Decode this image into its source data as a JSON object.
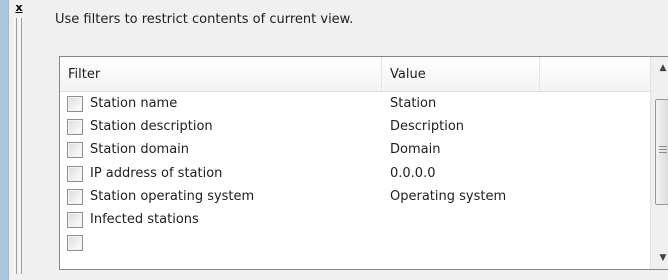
{
  "panel": {
    "close_label": "x",
    "instructions": "Use filters to restrict contents of current view."
  },
  "table": {
    "columns": [
      "Filter",
      "Value"
    ],
    "rows": [
      {
        "label": "Station name",
        "value": "Station"
      },
      {
        "label": "Station description",
        "value": "Description"
      },
      {
        "label": "Station domain",
        "value": "Domain"
      },
      {
        "label": "IP address of station",
        "value": "0.0.0.0"
      },
      {
        "label": "Station operating system",
        "value": "Operating system"
      },
      {
        "label": "Infected stations",
        "value": ""
      }
    ]
  },
  "colors": {
    "background": "#aac7de",
    "panel": "#f0f0f0"
  },
  "icons": {
    "scroll_up": "arrow-up",
    "scroll_down": "arrow-down"
  }
}
